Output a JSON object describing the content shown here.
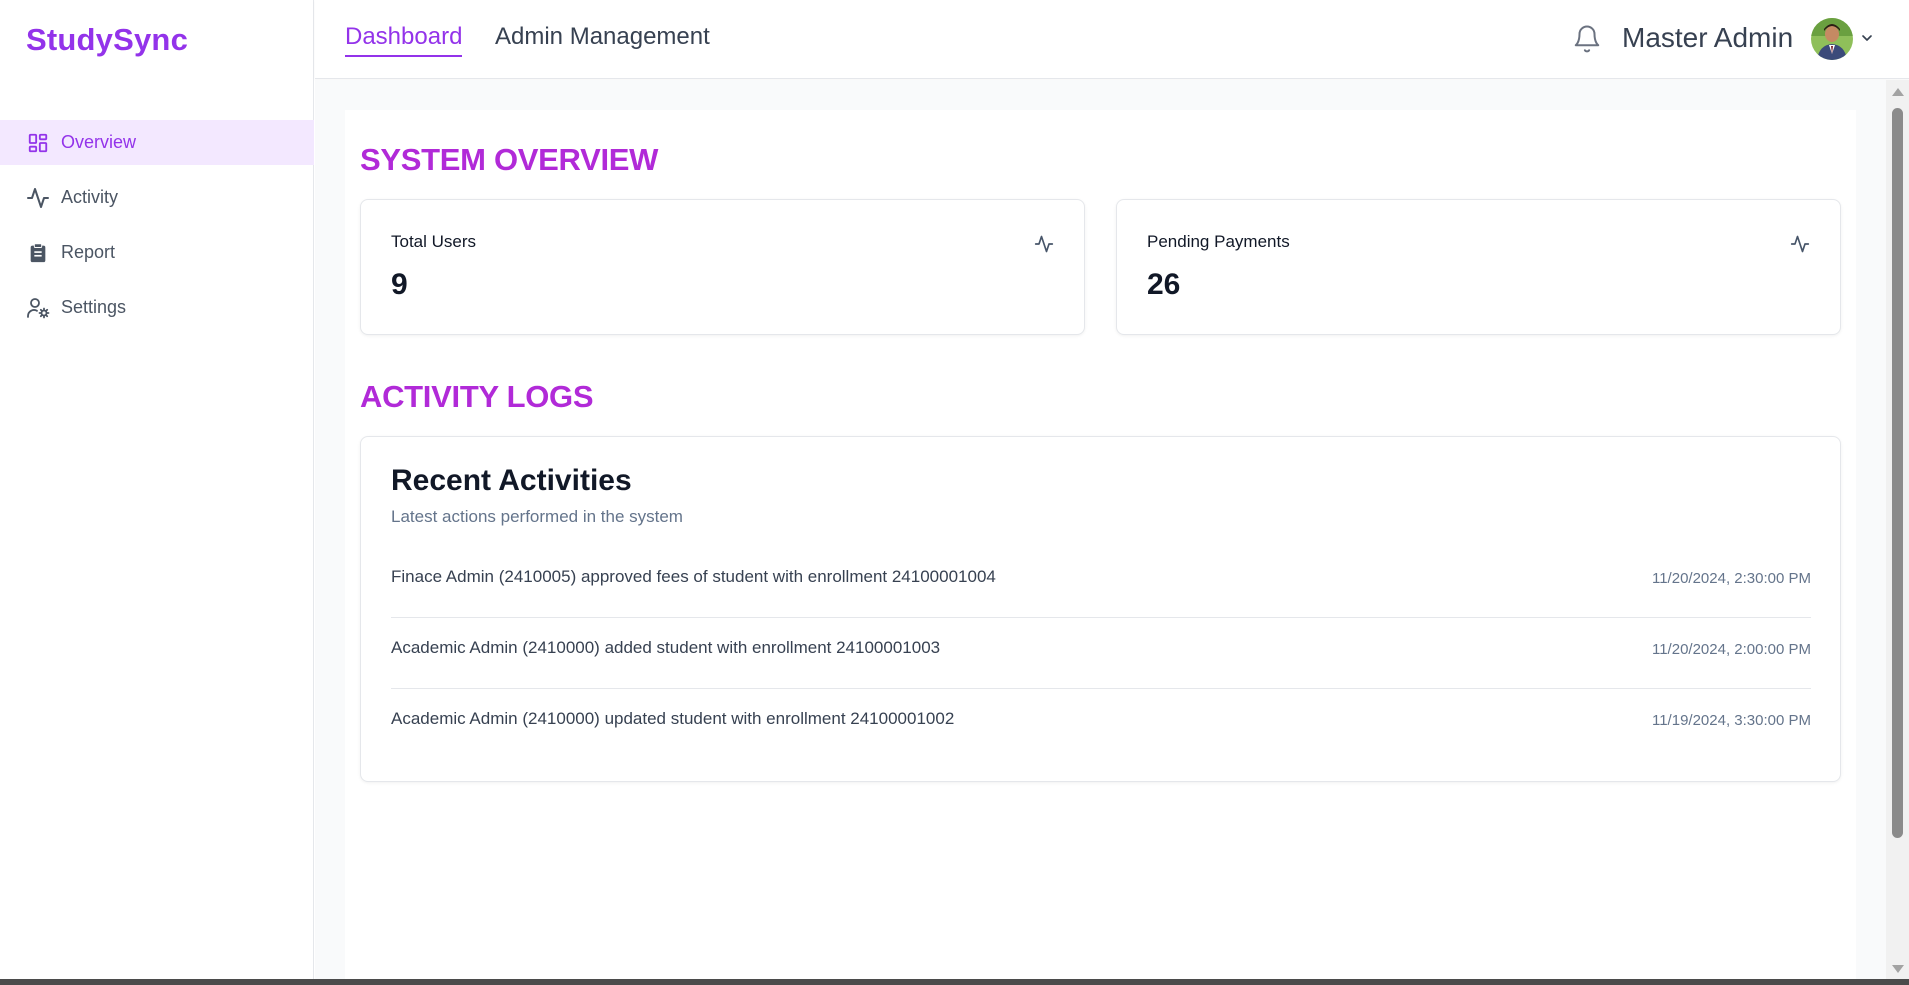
{
  "app": {
    "brand": "StudySync"
  },
  "sidebar": {
    "items": [
      {
        "label": "Overview",
        "icon": "dashboard-icon",
        "active": true
      },
      {
        "label": "Activity",
        "icon": "activity-icon",
        "active": false
      },
      {
        "label": "Report",
        "icon": "clipboard-icon",
        "active": false
      },
      {
        "label": "Settings",
        "icon": "user-settings-icon",
        "active": false
      }
    ]
  },
  "header": {
    "tabs": [
      {
        "label": "Dashboard",
        "active": true
      },
      {
        "label": "Admin Management",
        "active": false
      }
    ],
    "user_name": "Master Admin"
  },
  "overview": {
    "title": "SYSTEM OVERVIEW",
    "stats": [
      {
        "label": "Total Users",
        "value": "9"
      },
      {
        "label": "Pending Payments",
        "value": "26"
      }
    ]
  },
  "activity": {
    "section_title": "ACTIVITY LOGS",
    "card_title": "Recent Activities",
    "card_subtitle": "Latest actions performed in the system",
    "items": [
      {
        "text": "Finace Admin (2410005) approved fees of student with enrollment 24100001004",
        "time": "11/20/2024, 2:30:00 PM"
      },
      {
        "text": "Academic Admin (2410000) added student with enrollment 24100001003",
        "time": "11/20/2024, 2:00:00 PM"
      },
      {
        "text": "Academic Admin (2410000) updated student with enrollment 24100001002",
        "time": "11/19/2024, 3:30:00 PM"
      }
    ]
  },
  "colors": {
    "accent": "#9333ea",
    "section_title": "#b12ad8",
    "active_nav_bg": "#f3e8ff"
  }
}
